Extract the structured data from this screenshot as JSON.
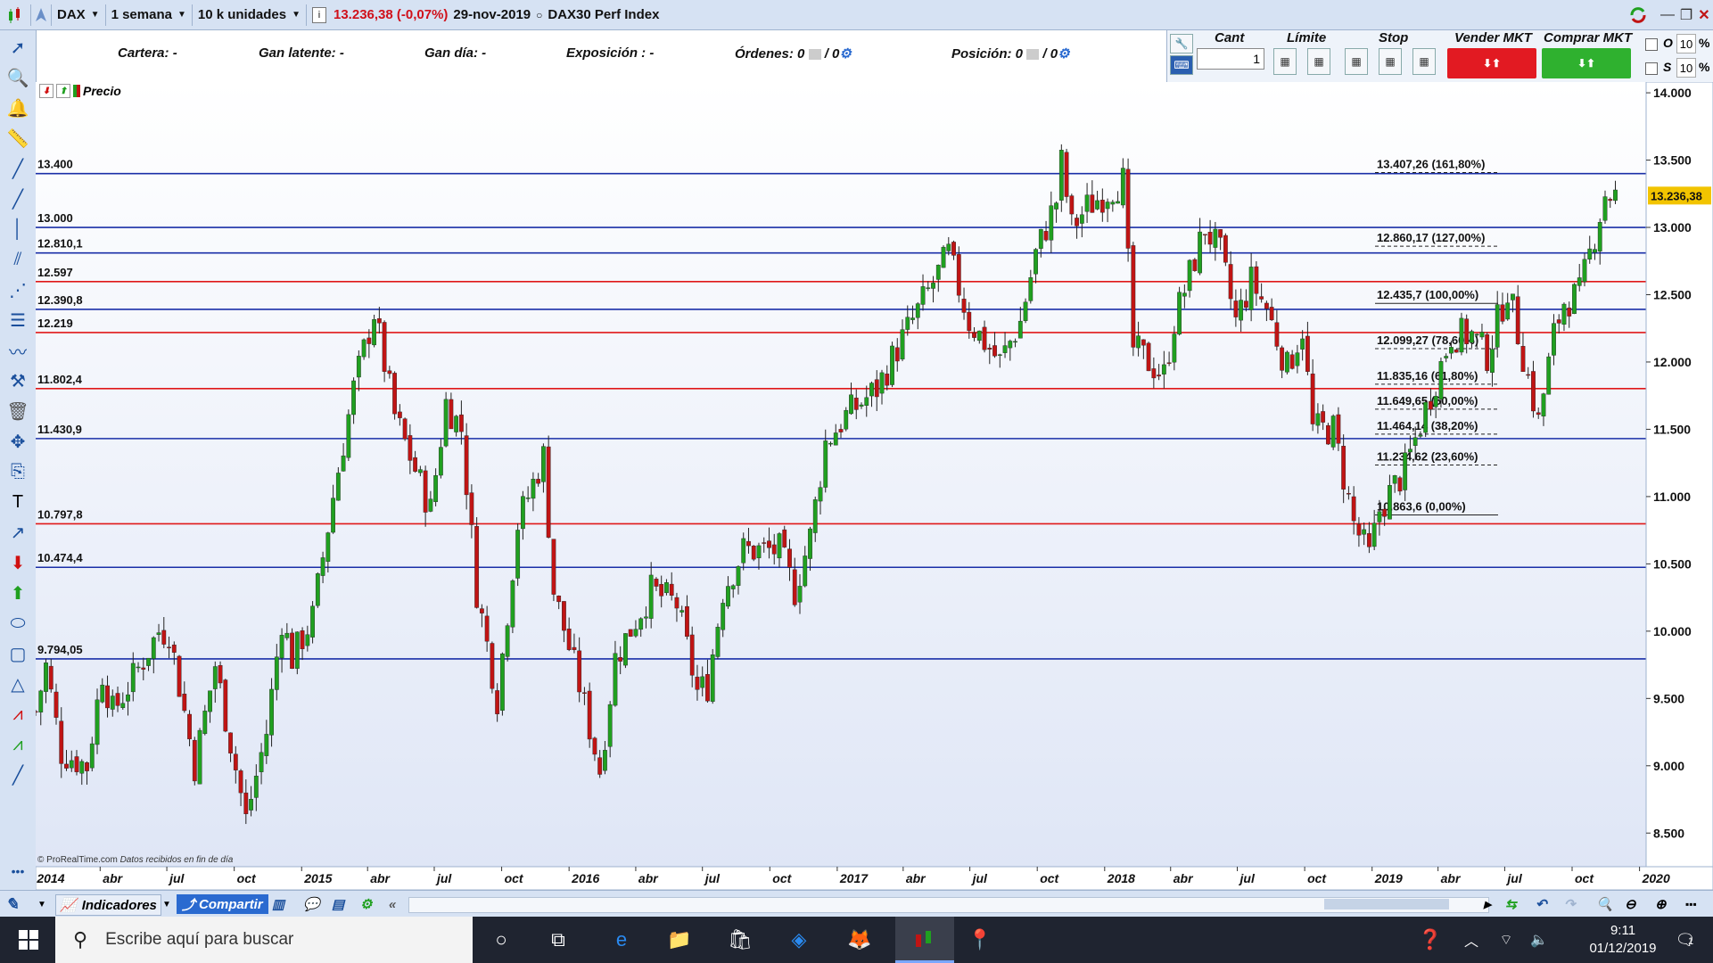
{
  "topbar": {
    "symbol": "DAX",
    "period": "1 semana",
    "units": "10 k unidades",
    "info_icon": "info-icon",
    "price_change": "13.236,38 (-0,07%)",
    "date": "29-nov-2019",
    "instrument": "DAX30 Perf Index"
  },
  "infobar": {
    "cartera": "Cartera: -",
    "gan_latente": "Gan latente: -",
    "gan_dia": "Gan día: -",
    "exposicion": "Exposición : -",
    "ordenes": "Órdenes: 0",
    "ordenes_b": "/ 0",
    "posicion": "Posición: 0",
    "posicion_b": "/ 0"
  },
  "order_panel": {
    "cant_label": "Cant",
    "cant_value": "1",
    "limite_label": "Límite",
    "stop_label": "Stop",
    "sell_label": "Vender MKT",
    "buy_label": "Comprar MKT",
    "o_label": "O",
    "s_label": "S",
    "o_pct": "10",
    "s_pct": "10",
    "pct_sign": "%"
  },
  "legend": {
    "series_label": "Precio"
  },
  "footer": {
    "copyright": "© ProRealTime.com",
    "note": "Datos recibidos en fin de día"
  },
  "bottombar": {
    "indicators": "Indicadores",
    "share": "Compartir"
  },
  "taskbar": {
    "search_placeholder": "Escribe aquí para buscar",
    "time": "9:11",
    "date": "01/12/2019",
    "notif_count": "1"
  },
  "colors": {
    "up": "#20a020",
    "down": "#c01414",
    "blue_line": "#1a2fa8",
    "red_line": "#e01818",
    "bg_top": "#ffffff",
    "bg_bottom": "#dfe6f6",
    "last_price_bg": "#f2c400"
  },
  "chart_data": {
    "type": "candlestick",
    "x_tick_labels": [
      "2014",
      "abr",
      "jul",
      "oct",
      "2015",
      "abr",
      "jul",
      "oct",
      "2016",
      "abr",
      "jul",
      "oct",
      "2017",
      "abr",
      "jul",
      "oct",
      "2018",
      "abr",
      "jul",
      "oct",
      "2019",
      "abr",
      "jul",
      "oct",
      "2020"
    ],
    "y_tick_labels": [
      "14.000",
      "13.500",
      "13.000",
      "12.500",
      "12.000",
      "11.500",
      "11.000",
      "10.500",
      "10.000",
      "9.500",
      "9.000",
      "8.500"
    ],
    "ylim": [
      8250,
      14080
    ],
    "x_range": [
      "2014-01-03",
      "2020-01-10"
    ],
    "last_price": 13236.38,
    "last_price_label": "13.236,38",
    "horizontal_levels": [
      {
        "value": 13400,
        "label": "13.400",
        "color": "blue"
      },
      {
        "value": 13000,
        "label": "13.000",
        "color": "blue"
      },
      {
        "value": 12810.1,
        "label": "12.810,1",
        "color": "blue"
      },
      {
        "value": 12597,
        "label": "12.597",
        "color": "red"
      },
      {
        "value": 12390.8,
        "label": "12.390,8",
        "color": "blue"
      },
      {
        "value": 12219,
        "label": "12.219",
        "color": "red"
      },
      {
        "value": 11802.4,
        "label": "11.802,4",
        "color": "red"
      },
      {
        "value": 11430.9,
        "label": "11.430,9",
        "color": "blue"
      },
      {
        "value": 10797.8,
        "label": "10.797,8",
        "color": "red"
      },
      {
        "value": 10474.4,
        "label": "10.474,4",
        "color": "blue"
      },
      {
        "value": 9794.05,
        "label": "9.794,05",
        "color": "blue"
      }
    ],
    "fibonacci": [
      {
        "value": 13407.26,
        "label": "13.407,26 (161,80%)"
      },
      {
        "value": 12860.17,
        "label": "12.860,17 (127,00%)"
      },
      {
        "value": 12435.7,
        "label": "12.435,7 (100,00%)"
      },
      {
        "value": 12099.27,
        "label": "12.099,27 (78,60%)"
      },
      {
        "value": 11835.16,
        "label": "11.835,16 (61,80%)"
      },
      {
        "value": 11649.65,
        "label": "11.649,65 (50,00%)"
      },
      {
        "value": 11464.14,
        "label": "11.464,14 (38,20%)"
      },
      {
        "value": 11234.62,
        "label": "11.234,62 (23,60%)"
      },
      {
        "value": 10863.6,
        "label": "10.863,6 (0,00%)"
      }
    ],
    "weekly_close_path": [
      [
        "2014-01-03",
        9400
      ],
      [
        "2014-01-17",
        9742
      ],
      [
        "2014-02-07",
        9100
      ],
      [
        "2014-03-14",
        9000
      ],
      [
        "2014-04-04",
        9695
      ],
      [
        "2014-04-18",
        9400
      ],
      [
        "2014-05-16",
        9650
      ],
      [
        "2014-06-20",
        10000
      ],
      [
        "2014-07-04",
        10000
      ],
      [
        "2014-08-08",
        9000
      ],
      [
        "2014-09-05",
        9750
      ],
      [
        "2014-10-17",
        8600
      ],
      [
        "2014-11-14",
        9250
      ],
      [
        "2014-12-05",
        10087
      ],
      [
        "2014-12-19",
        9800
      ],
      [
        "2015-01-16",
        10100
      ],
      [
        "2015-02-13",
        11000
      ],
      [
        "2015-03-13",
        11800
      ],
      [
        "2015-04-10",
        12374
      ],
      [
        "2015-05-08",
        11600
      ],
      [
        "2015-06-05",
        11200
      ],
      [
        "2015-06-26",
        10900
      ],
      [
        "2015-07-17",
        11700
      ],
      [
        "2015-08-07",
        11500
      ],
      [
        "2015-08-28",
        10300
      ],
      [
        "2015-09-25",
        9500
      ],
      [
        "2015-10-23",
        10800
      ],
      [
        "2015-11-27",
        11300
      ],
      [
        "2015-12-11",
        10300
      ],
      [
        "2016-01-15",
        9600
      ],
      [
        "2016-02-12",
        8967
      ],
      [
        "2016-03-04",
        9800
      ],
      [
        "2016-04-22",
        10300
      ],
      [
        "2016-05-27",
        10200
      ],
      [
        "2016-06-24",
        9550
      ],
      [
        "2016-07-08",
        9600
      ],
      [
        "2016-07-29",
        10300
      ],
      [
        "2016-08-26",
        10600
      ],
      [
        "2016-10-14",
        10600
      ],
      [
        "2016-11-04",
        10300
      ],
      [
        "2016-11-25",
        10700
      ],
      [
        "2016-12-16",
        11400
      ],
      [
        "2017-01-13",
        11600
      ],
      [
        "2017-02-24",
        11800
      ],
      [
        "2017-03-24",
        12100
      ],
      [
        "2017-04-28",
        12450
      ],
      [
        "2017-06-02",
        12800
      ],
      [
        "2017-06-30",
        12300
      ],
      [
        "2017-08-11",
        12000
      ],
      [
        "2017-09-08",
        12300
      ],
      [
        "2017-09-29",
        12800
      ],
      [
        "2017-10-27",
        13200
      ],
      [
        "2017-11-03",
        13478
      ],
      [
        "2017-11-17",
        13000
      ],
      [
        "2017-12-08",
        13150
      ],
      [
        "2018-01-12",
        13300
      ],
      [
        "2018-01-26",
        13340
      ],
      [
        "2018-02-09",
        12100
      ],
      [
        "2018-03-23",
        11900
      ],
      [
        "2018-04-06",
        12300
      ],
      [
        "2018-05-18",
        13000
      ],
      [
        "2018-06-08",
        12800
      ],
      [
        "2018-06-29",
        12300
      ],
      [
        "2018-07-20",
        12600
      ],
      [
        "2018-08-10",
        12400
      ],
      [
        "2018-09-07",
        11950
      ],
      [
        "2018-09-28",
        12250
      ],
      [
        "2018-10-12",
        11500
      ],
      [
        "2018-11-09",
        11500
      ],
      [
        "2018-12-07",
        10800
      ],
      [
        "2018-12-28",
        10550
      ],
      [
        "2019-01-11",
        10900
      ],
      [
        "2019-02-15",
        11200
      ],
      [
        "2019-03-15",
        11650
      ],
      [
        "2019-04-19",
        12200
      ],
      [
        "2019-05-17",
        12200
      ],
      [
        "2019-06-07",
        12050
      ],
      [
        "2019-07-05",
        12550
      ],
      [
        "2019-08-16",
        11550
      ],
      [
        "2019-09-06",
        12200
      ],
      [
        "2019-09-20",
        12450
      ],
      [
        "2019-10-11",
        12500
      ],
      [
        "2019-11-01",
        12950
      ],
      [
        "2019-11-15",
        13250
      ],
      [
        "2019-11-29",
        13236
      ]
    ]
  }
}
